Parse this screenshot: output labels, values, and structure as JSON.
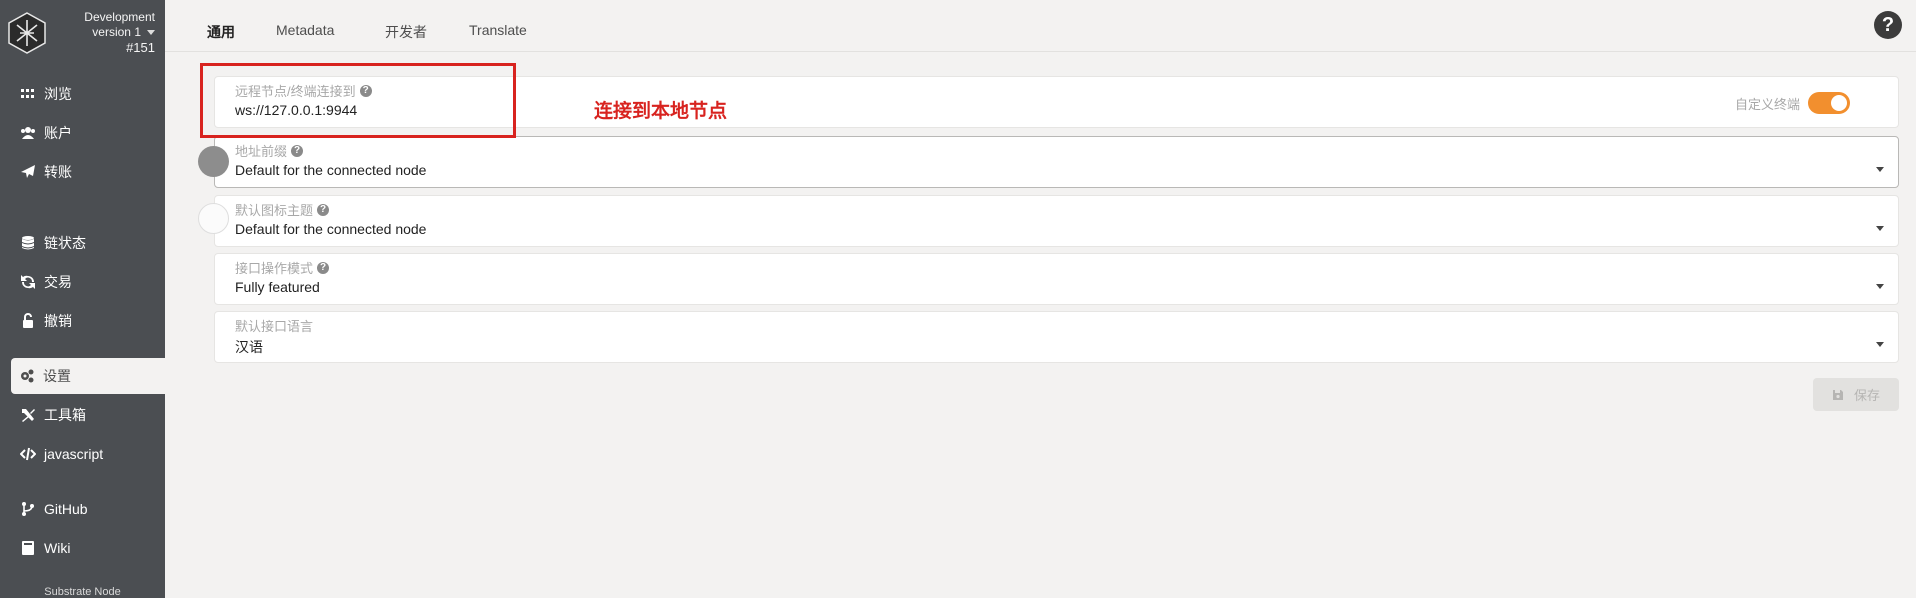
{
  "sidebar": {
    "chain": {
      "name": "Development",
      "version": "version 1",
      "block": "#151"
    },
    "items": [
      {
        "label": "浏览",
        "icon": "th-icon"
      },
      {
        "label": "账户",
        "icon": "users-icon"
      },
      {
        "label": "转账",
        "icon": "paper-plane-icon"
      },
      {
        "label": "链状态",
        "icon": "database-icon"
      },
      {
        "label": "交易",
        "icon": "sync-icon"
      },
      {
        "label": "撤销",
        "icon": "unlock-icon"
      },
      {
        "label": "设置",
        "icon": "cogs-icon"
      },
      {
        "label": "工具箱",
        "icon": "tools-icon"
      },
      {
        "label": "javascript",
        "icon": "code-icon"
      },
      {
        "label": "GitHub",
        "icon": "code-branch-icon"
      },
      {
        "label": "Wiki",
        "icon": "book-icon"
      }
    ],
    "footer": "Substrate Node"
  },
  "tabs": [
    {
      "label": "通用",
      "active": true
    },
    {
      "label": "Metadata",
      "active": false
    },
    {
      "label": "开发者",
      "active": false
    },
    {
      "label": "Translate",
      "active": false
    }
  ],
  "help": "?",
  "settings": {
    "endpoint": {
      "label": "远程节点/终端连接到",
      "value": "ws://127.0.0.1:9944",
      "custom_label": "自定义终端",
      "custom_enabled": true
    },
    "prefix": {
      "label": "地址前缀",
      "value": "Default for the connected node"
    },
    "icon_theme": {
      "label": "默认图标主题",
      "value": "Default for the connected node"
    },
    "ui_mode": {
      "label": "接口操作模式",
      "value": "Fully featured"
    },
    "language": {
      "label": "默认接口语言",
      "value": "汉语"
    }
  },
  "save_label": "保存",
  "annotation": "连接到本地节点",
  "colors": {
    "sidebar": "#4b4e52",
    "accent": "#f28f2e",
    "annotation": "#d8231f"
  }
}
